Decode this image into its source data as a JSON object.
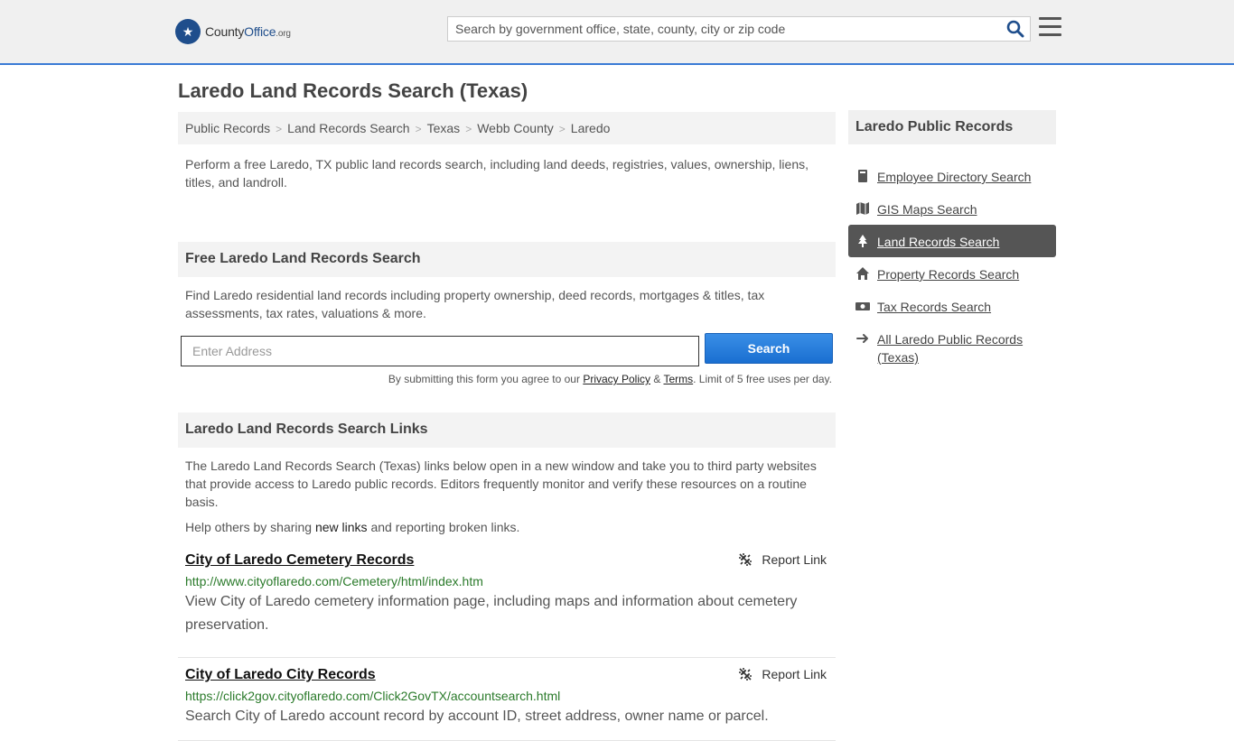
{
  "header": {
    "logo_county": "County",
    "logo_office": "Office",
    "logo_org": ".org",
    "search_placeholder": "Search by government office, state, county, city or zip code"
  },
  "page_title": "Laredo Land Records Search (Texas)",
  "breadcrumb": [
    "Public Records",
    "Land Records Search",
    "Texas",
    "Webb County",
    "Laredo"
  ],
  "intro": "Perform a free Laredo, TX public land records search, including land deeds, registries, values, ownership, liens, titles, and landroll.",
  "free_search": {
    "heading": "Free Laredo Land Records Search",
    "description": "Find Laredo residential land records including property ownership, deed records, mortgages & titles, tax assessments, tax rates, valuations & more.",
    "address_placeholder": "Enter Address",
    "button_label": "Search",
    "terms_prefix": "By submitting this form you agree to our ",
    "privacy_label": "Privacy Policy",
    "amp": " & ",
    "terms_label": "Terms",
    "terms_suffix": ". Limit of 5 free uses per day."
  },
  "links_section": {
    "heading": "Laredo Land Records Search Links",
    "description": "The Laredo Land Records Search (Texas) links below open in a new window and take you to third party websites that provide access to Laredo public records. Editors frequently monitor and verify these resources on a routine basis.",
    "help_prefix": "Help others by sharing ",
    "help_link": "new links",
    "help_suffix": " and reporting broken links.",
    "report_label": "Report Link",
    "records": [
      {
        "title": "City of Laredo Cemetery Records",
        "url": "http://www.cityoflaredo.com/Cemetery/html/index.htm",
        "description": "View City of Laredo cemetery information page, including maps and information about cemetery preservation."
      },
      {
        "title": "City of Laredo City Records",
        "url": "https://click2gov.cityoflaredo.com/Click2GovTX/accountsearch.html",
        "description": "Search City of Laredo account record by account ID, street address, owner name or parcel."
      }
    ]
  },
  "sidebar": {
    "heading": "Laredo Public Records",
    "items": [
      {
        "label": "Employee Directory Search",
        "icon": "book-icon"
      },
      {
        "label": "GIS Maps Search",
        "icon": "map-icon"
      },
      {
        "label": "Land Records Search",
        "icon": "tree-icon"
      },
      {
        "label": "Property Records Search",
        "icon": "home-icon"
      },
      {
        "label": "Tax Records Search",
        "icon": "money-icon"
      },
      {
        "label": "All Laredo Public Records (Texas)",
        "icon": "arrow-right-icon"
      }
    ]
  }
}
